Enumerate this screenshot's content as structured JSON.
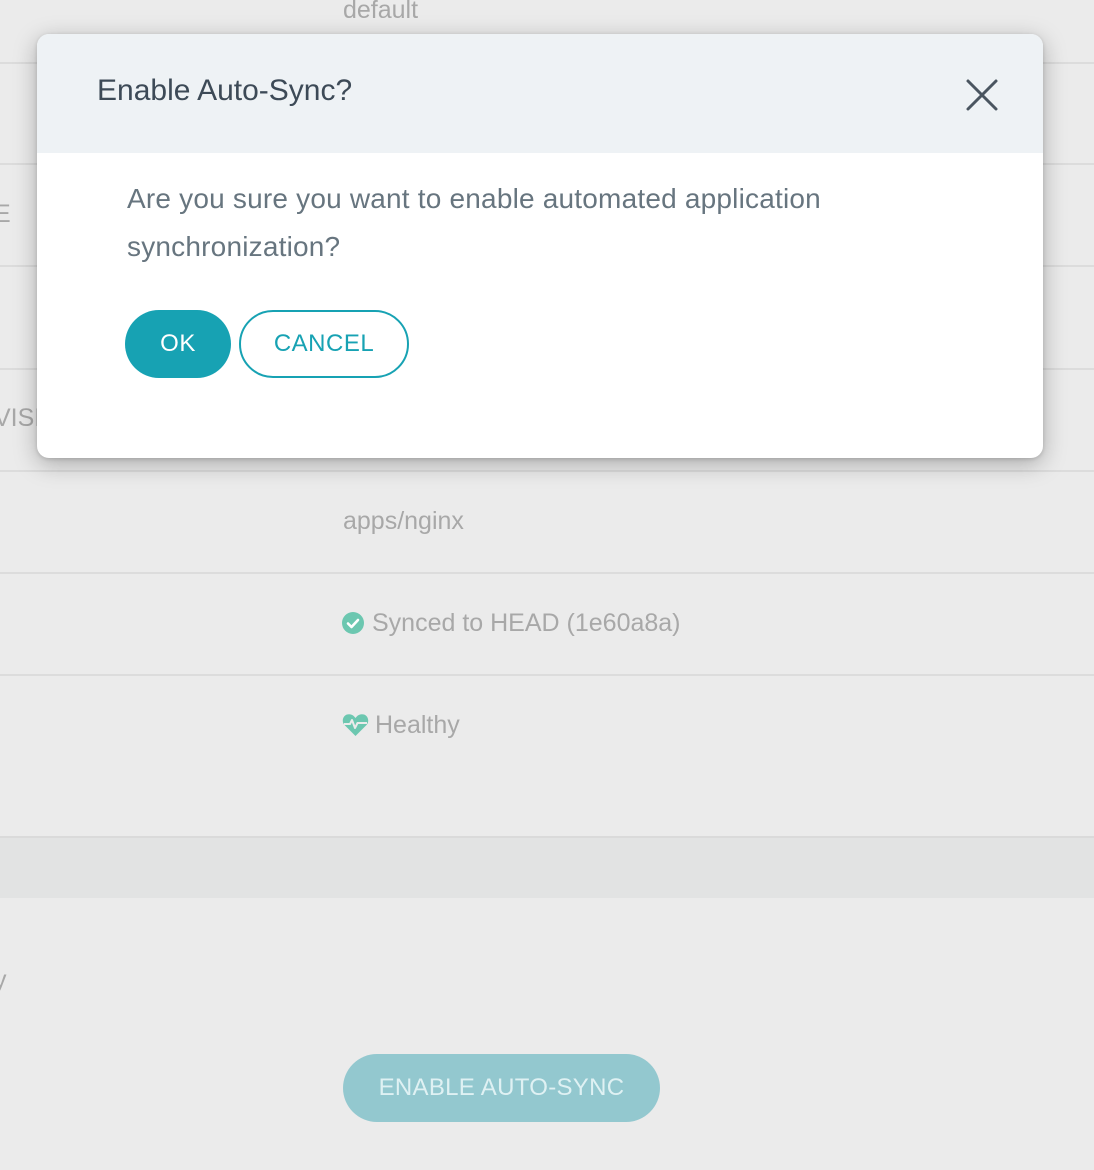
{
  "background": {
    "rows": {
      "project_value": "default",
      "left_edge_fragment_1": "E",
      "left_edge_fragment_2": "VISI",
      "path_value": "apps/nginx",
      "sync_status": "Synced to HEAD (1e60a8a)",
      "health_status": "Healthy",
      "left_edge_fragment_3": "y"
    },
    "enable_autosync_button": "ENABLE AUTO-SYNC"
  },
  "dialog": {
    "title": "Enable Auto-Sync?",
    "message": "Are you sure you want to enable automated application synchronization?",
    "ok_label": "OK",
    "cancel_label": "CANCEL",
    "close_icon": "close-icon"
  },
  "colors": {
    "accent": "#17a2b3",
    "header_bg": "#eef2f5",
    "title_text": "#3d4a57",
    "body_text": "#67757f",
    "status_ok": "#6cc7b0"
  }
}
